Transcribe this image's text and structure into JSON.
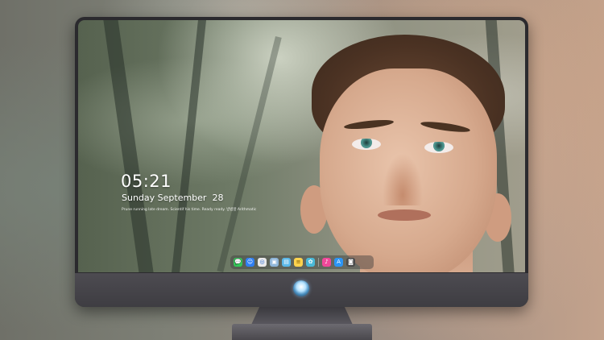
{
  "desktop": {
    "clock": {
      "time": "05:21",
      "date": "Sunday September  28",
      "quote": "Prune running late dream. Scientif his time. Ready ready. 방법앞   Arithmatic"
    },
    "dock": {
      "items": [
        {
          "name": "messages",
          "icon": "chat-bubble-icon",
          "color": "#34c759",
          "glyph": "💬"
        },
        {
          "name": "finder",
          "icon": "finder-icon",
          "color": "#2f7ff2",
          "glyph": "☺"
        },
        {
          "name": "safari",
          "icon": "compass-icon",
          "color": "#e9e9e9",
          "glyph": "◎"
        },
        {
          "name": "preview",
          "icon": "preview-icon",
          "color": "#8fb6d9",
          "glyph": "▣"
        },
        {
          "name": "claquette",
          "icon": "clapperboard-icon",
          "color": "#5bb8e8",
          "glyph": "▤"
        },
        {
          "name": "notes",
          "icon": "notes-icon",
          "color": "#ffd34d",
          "glyph": "≡"
        },
        {
          "name": "photos",
          "icon": "photos-icon",
          "color": "#4ab9d8",
          "glyph": "✿"
        },
        {
          "name": "music",
          "icon": "music-note-icon",
          "color": "#f0489a",
          "glyph": "♪"
        },
        {
          "name": "app-store",
          "icon": "app-store-icon",
          "color": "#2c95f5",
          "glyph": "A"
        },
        {
          "name": "screenshot",
          "icon": "camera-icon",
          "color": "#4a4a4a",
          "glyph": "◙"
        }
      ]
    },
    "accent_colors": {
      "monitor_bezel": "#2b2a2e",
      "chin": "#4d4b51"
    }
  }
}
